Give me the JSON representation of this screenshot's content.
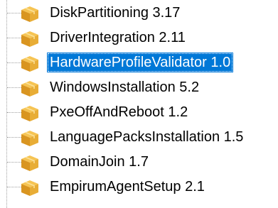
{
  "tree": {
    "items": [
      {
        "label": "DiskPartitioning 3.17",
        "icon": "package-box-icon",
        "selected": false
      },
      {
        "label": "DriverIntegration 2.11",
        "icon": "package-box-icon",
        "selected": false
      },
      {
        "label": "HardwareProfileValidator 1.0",
        "icon": "package-box-icon",
        "selected": true
      },
      {
        "label": "WindowsInstallation 5.2",
        "icon": "package-box-icon",
        "selected": false
      },
      {
        "label": "PxeOffAndReboot 1.2",
        "icon": "package-box-icon",
        "selected": false
      },
      {
        "label": "LanguagePacksInstallation 1.5",
        "icon": "package-box-icon",
        "selected": false
      },
      {
        "label": "DomainJoin 1.7",
        "icon": "package-box-icon",
        "selected": false
      },
      {
        "label": "EmpirumAgentSetup 2.1",
        "icon": "package-box-icon",
        "selected": false
      }
    ]
  },
  "colors": {
    "selection_bg": "#0078d7",
    "selection_text": "#ffffff",
    "box_top": "#f6c453",
    "box_side": "#d99520",
    "box_front": "#e8ad36"
  }
}
